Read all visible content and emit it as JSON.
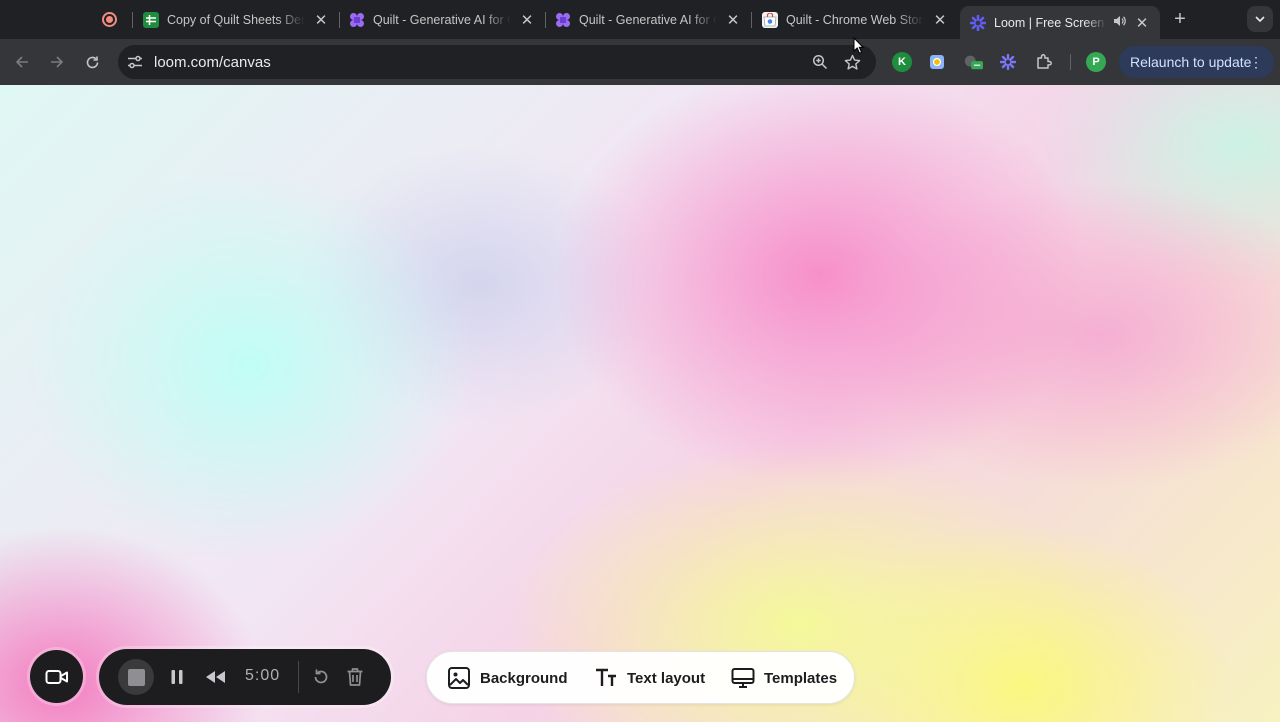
{
  "tabs": [
    {
      "title": "Copy of Quilt Sheets Demo",
      "favicon": "google-sheets-icon",
      "active": false
    },
    {
      "title": "Quilt - Generative AI for Google",
      "favicon": "quilt-icon",
      "active": false
    },
    {
      "title": "Quilt - Generative AI for Google",
      "favicon": "quilt-icon",
      "active": false
    },
    {
      "title": "Quilt - Chrome Web Store",
      "favicon": "chrome-web-store-icon",
      "active": false
    },
    {
      "title": "Loom | Free Screen & Video Recording",
      "favicon": "loom-icon",
      "active": true,
      "audio": true
    }
  ],
  "address_bar": {
    "url": "loom.com/canvas"
  },
  "toolbar": {
    "relaunch_label": "Relaunch to update",
    "profile_initial": "P",
    "extension_k_label": "K"
  },
  "recorder": {
    "timer": "5:00"
  },
  "canvas_panel": {
    "background_label": "Background",
    "text_layout_label": "Text layout",
    "templates_label": "Templates"
  },
  "colors": {
    "chrome_dark": "#202124",
    "toolbar": "#35363a",
    "relaunch_bg": "#2d3a5a",
    "loom_purple": "#625df5",
    "recorder_bg": "#1d1d1f"
  }
}
